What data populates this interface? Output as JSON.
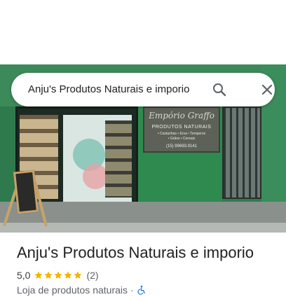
{
  "search": {
    "query": "Anju's Produtos Naturais e imporio",
    "search_icon": "search-icon",
    "close_icon": "close-icon"
  },
  "photo": {
    "sign_line1": "Empório Graffo",
    "sign_line2": "PRODUTOS NATURAIS",
    "sign_line3": "• Castanhas • Erva • Temperos",
    "sign_line4": "• Grãos • Cereais",
    "sign_line5": "(15) 99693.9141"
  },
  "place": {
    "name": "Anju's Produtos Naturais e imporio",
    "rating": "5,0",
    "stars": 5,
    "review_count": "(2)",
    "category": "Loja de produtos naturais",
    "separator": "·",
    "accessibility_icon": "wheelchair-icon"
  },
  "colors": {
    "star": "#f4b400",
    "accessibility": "#1a73e8"
  }
}
